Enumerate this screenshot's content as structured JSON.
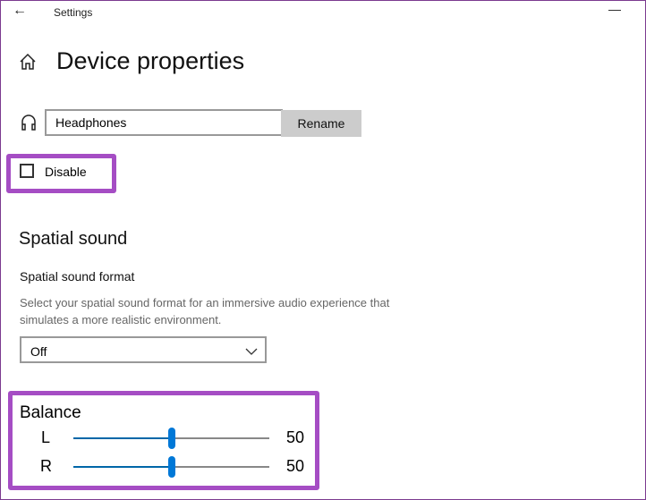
{
  "window": {
    "title": "Settings",
    "back_icon": "arrow-left-icon",
    "minimize_icon": "minimize-icon"
  },
  "page": {
    "title": "Device properties",
    "home_icon": "home-icon"
  },
  "device": {
    "icon": "headphones-icon",
    "name_value": "Headphones",
    "rename_label": "Rename"
  },
  "disable": {
    "label": "Disable",
    "checked": false
  },
  "spatial": {
    "heading": "Spatial sound",
    "format_label": "Spatial sound format",
    "description": "Select your spatial sound format for an immersive audio experience that simulates a more realistic environment.",
    "selected": "Off"
  },
  "balance": {
    "heading": "Balance",
    "channels": [
      {
        "label": "L",
        "value": 50,
        "display": "50"
      },
      {
        "label": "R",
        "value": 50,
        "display": "50"
      }
    ]
  },
  "colors": {
    "highlight": "#a54dc4",
    "accent": "#0078d7"
  }
}
